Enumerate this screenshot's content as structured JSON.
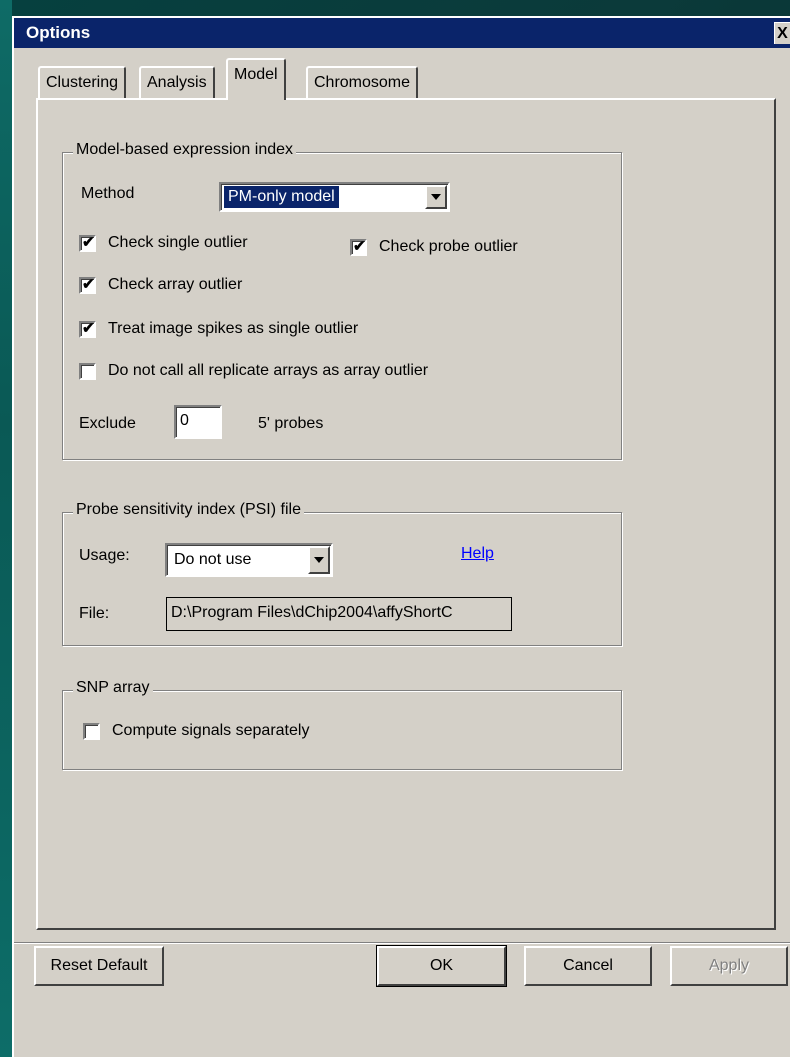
{
  "window": {
    "title": "Options",
    "close_label": "X"
  },
  "tabs": [
    {
      "label": "Clustering",
      "active": false
    },
    {
      "label": "Analysis",
      "active": false
    },
    {
      "label": "Model",
      "active": true
    },
    {
      "label": "Chromosome",
      "active": false
    }
  ],
  "model_group": {
    "title": "Model-based expression index",
    "method_label": "Method",
    "method_value": "PM-only model",
    "checkboxes": {
      "single_outlier": {
        "label": "Check single outlier",
        "checked": true
      },
      "probe_outlier": {
        "label": "Check probe outlier",
        "checked": true
      },
      "array_outlier": {
        "label": "Check array outlier",
        "checked": true
      },
      "image_spikes": {
        "label": "Treat image spikes as single outlier",
        "checked": true
      },
      "replicate_arrays": {
        "label": "Do not call all replicate arrays as array outlier",
        "checked": false
      }
    },
    "exclude_label": "Exclude",
    "exclude_value": "0",
    "probes_label": "5' probes"
  },
  "psi_group": {
    "title": "Probe sensitivity index (PSI) file",
    "usage_label": "Usage:",
    "usage_value": "Do not use",
    "help_link": "Help",
    "file_label": "File:",
    "file_value": "D:\\Program Files\\dChip2004\\affyShortC"
  },
  "snp_group": {
    "title": "SNP array",
    "compute_separately": {
      "label": "Compute signals separately",
      "checked": false
    }
  },
  "buttons": {
    "reset_default": "Reset Default",
    "ok": "OK",
    "cancel": "Cancel",
    "apply": "Apply"
  },
  "check_glyph": "✔"
}
